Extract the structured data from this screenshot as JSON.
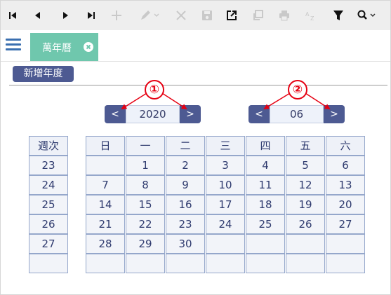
{
  "tab": {
    "label": "萬年曆"
  },
  "add_year_label": "新增年度",
  "year": {
    "prev": "<",
    "value": "2020",
    "next": ">"
  },
  "month": {
    "prev": "<",
    "value": "06",
    "next": ">"
  },
  "annotations": [
    "①",
    "②"
  ],
  "week_header": "週次",
  "weekdays": [
    "日",
    "一",
    "二",
    "三",
    "四",
    "五",
    "六"
  ],
  "week_numbers": [
    "23",
    "24",
    "25",
    "26",
    "27",
    ""
  ],
  "days": [
    [
      "",
      "1",
      "2",
      "3",
      "4",
      "5",
      "6"
    ],
    [
      "7",
      "8",
      "9",
      "10",
      "11",
      "12",
      "13"
    ],
    [
      "14",
      "15",
      "16",
      "17",
      "18",
      "19",
      "20"
    ],
    [
      "21",
      "22",
      "23",
      "24",
      "25",
      "26",
      "27"
    ],
    [
      "28",
      "29",
      "30",
      "",
      "",
      "",
      ""
    ],
    [
      "",
      "",
      "",
      "",
      "",
      "",
      ""
    ]
  ],
  "colors": {
    "accent": "#4d5a92",
    "tab": "#6fc7ad",
    "annotation": "#e60012",
    "cell_border": "#95a7cb"
  },
  "toolbar_icons": [
    "first-record-icon",
    "prev-record-icon",
    "next-record-icon",
    "last-record-icon",
    "add-icon",
    "edit-icon",
    "delete-icon",
    "save-icon",
    "open-external-icon",
    "copy-icon",
    "print-icon",
    "sort-az-icon",
    "filter-icon",
    "search-icon"
  ]
}
